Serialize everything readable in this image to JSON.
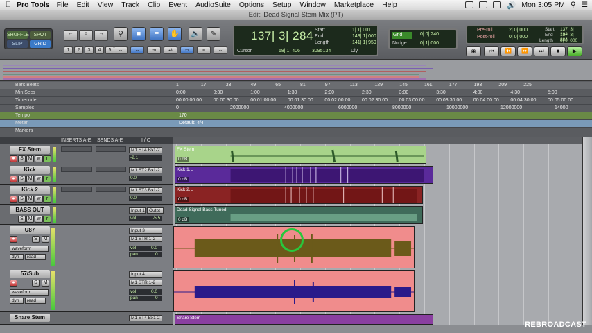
{
  "menubar": {
    "app": "Pro Tools",
    "items": [
      "File",
      "Edit",
      "View",
      "Track",
      "Clip",
      "Event",
      "AudioSuite",
      "Options",
      "Setup",
      "Window",
      "Marketplace",
      "Help"
    ],
    "clock": "Mon 3:05 PM"
  },
  "window": {
    "title": "Edit: Dead Signal Stem Mix (PT)"
  },
  "edit_modes": [
    "SHUFFLE",
    "SPOT",
    "SLIP",
    "GRID"
  ],
  "zoom_presets": [
    "1",
    "2",
    "3",
    "4",
    "5"
  ],
  "counter": {
    "main": "137| 3| 284",
    "cursor_label": "Cursor",
    "cursor_value": "68| 1| 406",
    "sample_value": "3095134",
    "start_label": "Start",
    "start_value": "1| 1| 001",
    "end_label": "End",
    "end_value": "143| 1| 000",
    "length_label": "Length",
    "length_value": "141| 1| 959",
    "dly": "Dly"
  },
  "grid": {
    "grid_label": "Grid",
    "grid_value": "0| 0| 240",
    "nudge_label": "Nudge",
    "nudge_value": "0| 1| 000"
  },
  "preroll": {
    "preroll_label": "Pre-roll",
    "preroll_value": "2| 0| 000",
    "postroll_label": "Post-roll",
    "postroll_value": "0| 0| 000",
    "start_label": "Start",
    "start_value": "137| 3| 284",
    "end_label": "End",
    "end_value": "137| 3| 284",
    "length_label": "Length",
    "length_value": "0| 0| 000"
  },
  "rulers": {
    "labels": [
      "Bars|Beats",
      "Min:Secs",
      "Timecode",
      "Samples",
      "Tempo",
      "Meter",
      "Markers"
    ],
    "bars": [
      "1",
      "17",
      "33",
      "49",
      "65",
      "81",
      "97",
      "113",
      "129",
      "145",
      "161",
      "177",
      "193",
      "209",
      "225"
    ],
    "minsecs": [
      "0:00",
      "0:30",
      "1:00",
      "1:30",
      "2:00",
      "2:30",
      "3:00",
      "3:30",
      "4:00",
      "4:30",
      "5:00"
    ],
    "timecode": [
      "00:00:00:00",
      "00:00:30:00",
      "00:01:00:00",
      "00:01:30:00",
      "00:02:00:00",
      "00:02:30:00",
      "00:03:00:00",
      "00:03:30:00",
      "00:04:00:00",
      "00:04:30:00",
      "00:05:00:00"
    ],
    "samples": [
      "0",
      "2000000",
      "4000000",
      "6000000",
      "8000000",
      "10000000",
      "12000000",
      "14000"
    ],
    "tempo": "170",
    "meter": "Default: 4/4"
  },
  "track_header": {
    "inserts": "INSERTS A-E",
    "sends": "SENDS A-E",
    "io": "I / O"
  },
  "tracks": [
    {
      "name": "FX Stem",
      "input": "M1 ST4",
      "output": "Bx1-2",
      "vol": "-2.1",
      "pan": "P  P",
      "clip": "FX Stem",
      "clip_db": "0 dB"
    },
    {
      "name": "Kick",
      "input": "M1 ST2",
      "output": "Bx1-2",
      "vol": "0.0",
      "pan": "0  0",
      "clip": "Kick 1.L",
      "clip_db": "0 dB"
    },
    {
      "name": "Kick 2",
      "input": "M1 ST3",
      "output": "Bx1-2",
      "vol": "0.0",
      "pan": "0  0",
      "clip": "Kick 2.L",
      "clip_db": "0 dB"
    },
    {
      "name": "BASS OUT",
      "input": "Input 1",
      "output": "Outpt",
      "vol": "vol",
      "vol_value": "-5.5",
      "clip": "Dead Signal Bass Tuned",
      "clip_db": "0 dB"
    },
    {
      "name": "U87",
      "input": "Input 3",
      "output": "M1 STR 1-2",
      "view": "waveform",
      "dyn": "dyn",
      "read": "read",
      "vol": "vol",
      "vol_value": "0.0",
      "pan": "pan",
      "pan_value": "0"
    },
    {
      "name": "57/Sub",
      "input": "Input 4",
      "output": "M1 STR 1-2",
      "view": "waveform",
      "dyn": "dyn",
      "read": "read",
      "vol": "vol",
      "vol_value": "0.0",
      "pan": "pan",
      "pan_value": "0"
    },
    {
      "name": "Snare Stem",
      "input": "M1 ST4",
      "output": "Bx1-2",
      "clip": "Snare Stem"
    }
  ],
  "colors": {
    "fx": "#a8d48a",
    "kick": "#5a2a9a",
    "kick2": "#8a2323",
    "bass": "#3f6b5a",
    "vocal_bg": "#f08c8c",
    "vocal_wave1": "#6b5a1a",
    "vocal_wave2": "#2a1a8a",
    "snare": "#8a3fa0"
  },
  "watermark": "REBROADCAST"
}
